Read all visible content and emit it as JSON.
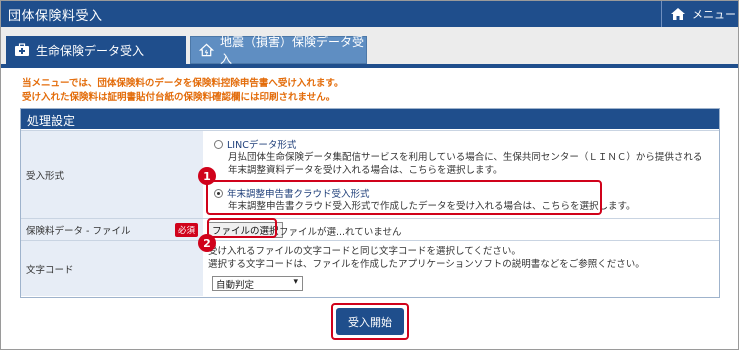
{
  "app": {
    "title": "団体保険料受入",
    "menu_label": "メニュー"
  },
  "tabs": [
    {
      "label": "生命保険データ受入",
      "active": true
    },
    {
      "label": "地震（損害）保険データ受入",
      "active": false
    }
  ],
  "notices": [
    "当メニューでは、団体保険料のデータを保険料控除申告書へ受け入れます。",
    "受け入れた保険料は証明書貼付台紙の保険料確認欄には印刷されません。"
  ],
  "panel": {
    "title": "処理設定",
    "rows": {
      "format": {
        "label": "受入形式",
        "options": [
          {
            "title": "LINCデータ形式",
            "desc1": "月払団体生命保険データ集配信サービスを利用している場合に、生保共同センター（ＬＩＮＣ）から提供される",
            "desc2": "年末調整資料データを受け入れる場合は、こちらを選択します。",
            "selected": false
          },
          {
            "title": "年末調整申告書クラウド受入形式",
            "desc1": "年末調整申告書クラウド受入形式で作成したデータを受け入れる場合は、こちらを選択します。",
            "selected": true
          }
        ]
      },
      "file": {
        "label": "保険料データ - ファイル",
        "required": "必須",
        "button": "ファイルの選択",
        "status": "ファイルが選...れていません"
      },
      "encoding": {
        "label": "文字コード",
        "desc1": "受け入れるファイルの文字コードと同じ文字コードを選択してください。",
        "desc2": "選択する文字コードは、ファイルを作成したアプリケーションソフトの説明書などをご参照ください。",
        "selected": "自動判定"
      }
    }
  },
  "actions": {
    "start": "受入開始"
  },
  "callouts": [
    "1",
    "2"
  ],
  "colors": {
    "primary": "#1f4e8c",
    "accent": "#d0021b",
    "notice": "#e36c0a"
  }
}
